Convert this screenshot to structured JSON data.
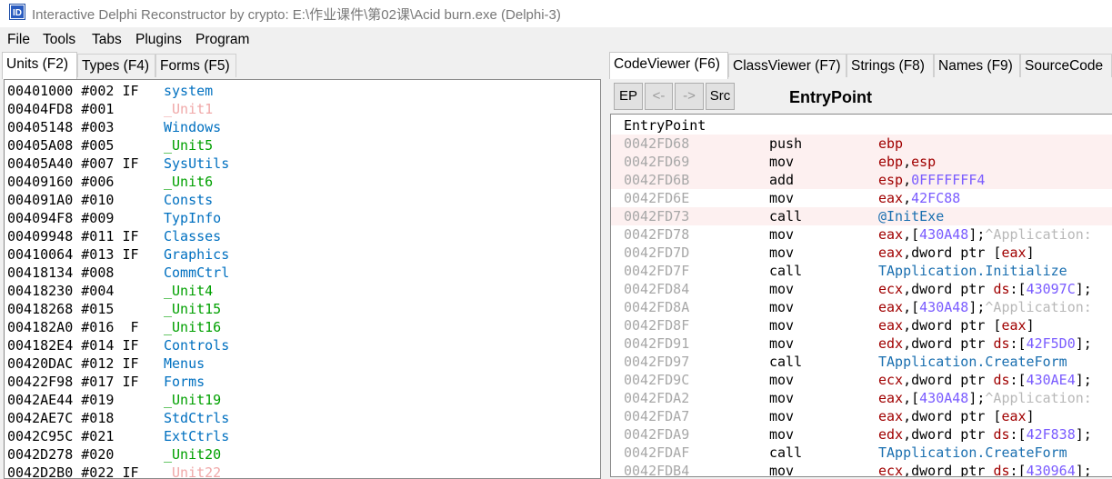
{
  "window": {
    "title": "Interactive Delphi Reconstructor by crypto: E:\\作业课件\\第02课\\Acid burn.exe (Delphi-3)",
    "icon": "idr-app-icon"
  },
  "menu": [
    "File",
    "Tools",
    "Tabs",
    "Plugins",
    "Program"
  ],
  "left_tabs": [
    "Units (F2)",
    "Types (F4)",
    "Forms (F5)"
  ],
  "units": [
    {
      "addr": "00401000",
      "num": "#002",
      "flag": "IF",
      "name": "system",
      "color": "#0070c0"
    },
    {
      "addr": "00404FD8",
      "num": "#001",
      "flag": "",
      "name": "_Unit1",
      "color": "#f0a8a8"
    },
    {
      "addr": "00405148",
      "num": "#003",
      "flag": "",
      "name": "Windows",
      "color": "#0070c0"
    },
    {
      "addr": "00405A08",
      "num": "#005",
      "flag": "",
      "name": "_Unit5",
      "color": "#00a000"
    },
    {
      "addr": "00405A40",
      "num": "#007",
      "flag": "IF",
      "name": "SysUtils",
      "color": "#0070c0"
    },
    {
      "addr": "00409160",
      "num": "#006",
      "flag": "",
      "name": "_Unit6",
      "color": "#00a000"
    },
    {
      "addr": "004091A0",
      "num": "#010",
      "flag": "",
      "name": "Consts",
      "color": "#0070c0"
    },
    {
      "addr": "004094F8",
      "num": "#009",
      "flag": "",
      "name": "TypInfo",
      "color": "#0070c0"
    },
    {
      "addr": "00409948",
      "num": "#011",
      "flag": "IF",
      "name": "Classes",
      "color": "#0070c0"
    },
    {
      "addr": "00410064",
      "num": "#013",
      "flag": "IF",
      "name": "Graphics",
      "color": "#0070c0"
    },
    {
      "addr": "00418134",
      "num": "#008",
      "flag": "",
      "name": "CommCtrl",
      "color": "#0070c0"
    },
    {
      "addr": "00418230",
      "num": "#004",
      "flag": "",
      "name": "_Unit4",
      "color": "#00a000"
    },
    {
      "addr": "00418268",
      "num": "#015",
      "flag": "",
      "name": "_Unit15",
      "color": "#00a000"
    },
    {
      "addr": "004182A0",
      "num": "#016",
      "flag": " F",
      "name": "_Unit16",
      "color": "#00a000"
    },
    {
      "addr": "004182E4",
      "num": "#014",
      "flag": "IF",
      "name": "Controls",
      "color": "#0070c0"
    },
    {
      "addr": "00420DAC",
      "num": "#012",
      "flag": "IF",
      "name": "Menus",
      "color": "#0070c0"
    },
    {
      "addr": "00422F98",
      "num": "#017",
      "flag": "IF",
      "name": "Forms",
      "color": "#0070c0"
    },
    {
      "addr": "0042AE44",
      "num": "#019",
      "flag": "",
      "name": "_Unit19",
      "color": "#00a000"
    },
    {
      "addr": "0042AE7C",
      "num": "#018",
      "flag": "",
      "name": "StdCtrls",
      "color": "#0070c0"
    },
    {
      "addr": "0042C95C",
      "num": "#021",
      "flag": "",
      "name": "ExtCtrls",
      "color": "#0070c0"
    },
    {
      "addr": "0042D278",
      "num": "#020",
      "flag": "",
      "name": "_Unit20",
      "color": "#00a000"
    },
    {
      "addr": "0042D2B0",
      "num": "#022",
      "flag": "IF",
      "name": "_Unit22",
      "color": "#f0a8a8"
    }
  ],
  "right_tabs": [
    "CodeViewer (F6)",
    "ClassViewer (F7)",
    "Strings (F8)",
    "Names (F9)",
    "SourceCode"
  ],
  "toolbar": {
    "buttons": [
      {
        "label": "EP",
        "enabled": true
      },
      {
        "label": "<-",
        "enabled": false
      },
      {
        "label": "->",
        "enabled": false
      },
      {
        "label": "Src",
        "enabled": true
      }
    ],
    "proc_name": "EntryPoint"
  },
  "code": {
    "header": "EntryPoint",
    "rows": [
      {
        "addr": "0042FD68",
        "mnem": "push",
        "hl": true,
        "ops": [
          {
            "t": "ebp",
            "c": "reg"
          }
        ]
      },
      {
        "addr": "0042FD69",
        "mnem": "mov",
        "hl": true,
        "ops": [
          {
            "t": "ebp",
            "c": "reg"
          },
          {
            "t": ",",
            "c": "pl"
          },
          {
            "t": "esp",
            "c": "reg"
          }
        ]
      },
      {
        "addr": "0042FD6B",
        "mnem": "add",
        "hl": true,
        "ops": [
          {
            "t": "esp",
            "c": "reg"
          },
          {
            "t": ",",
            "c": "pl"
          },
          {
            "t": "0FFFFFFF4",
            "c": "num"
          }
        ]
      },
      {
        "addr": "0042FD6E",
        "mnem": "mov",
        "hl": false,
        "ops": [
          {
            "t": "eax",
            "c": "reg"
          },
          {
            "t": ",",
            "c": "pl"
          },
          {
            "t": "42FC88",
            "c": "num"
          }
        ]
      },
      {
        "addr": "0042FD73",
        "mnem": "call",
        "hl": true,
        "ops": [
          {
            "t": "@InitExe",
            "c": "sym"
          }
        ]
      },
      {
        "addr": "0042FD78",
        "mnem": "mov",
        "hl": false,
        "ops": [
          {
            "t": "eax",
            "c": "reg"
          },
          {
            "t": ",[",
            "c": "pl"
          },
          {
            "t": "430A48",
            "c": "num"
          },
          {
            "t": "];",
            "c": "pl"
          },
          {
            "t": "^Application:",
            "c": "cmt"
          }
        ]
      },
      {
        "addr": "0042FD7D",
        "mnem": "mov",
        "hl": false,
        "ops": [
          {
            "t": "eax",
            "c": "reg"
          },
          {
            "t": ",dword ptr [",
            "c": "pl"
          },
          {
            "t": "eax",
            "c": "reg"
          },
          {
            "t": "]",
            "c": "pl"
          }
        ]
      },
      {
        "addr": "0042FD7F",
        "mnem": "call",
        "hl": false,
        "ops": [
          {
            "t": "TApplication.Initialize",
            "c": "sym"
          }
        ]
      },
      {
        "addr": "0042FD84",
        "mnem": "mov",
        "hl": false,
        "ops": [
          {
            "t": "ecx",
            "c": "reg"
          },
          {
            "t": ",dword ptr ",
            "c": "pl"
          },
          {
            "t": "ds",
            "c": "reg"
          },
          {
            "t": ":[",
            "c": "pl"
          },
          {
            "t": "43097C",
            "c": "num"
          },
          {
            "t": "];",
            "c": "pl"
          }
        ]
      },
      {
        "addr": "0042FD8A",
        "mnem": "mov",
        "hl": false,
        "ops": [
          {
            "t": "eax",
            "c": "reg"
          },
          {
            "t": ",[",
            "c": "pl"
          },
          {
            "t": "430A48",
            "c": "num"
          },
          {
            "t": "];",
            "c": "pl"
          },
          {
            "t": "^Application:",
            "c": "cmt"
          }
        ]
      },
      {
        "addr": "0042FD8F",
        "mnem": "mov",
        "hl": false,
        "ops": [
          {
            "t": "eax",
            "c": "reg"
          },
          {
            "t": ",dword ptr [",
            "c": "pl"
          },
          {
            "t": "eax",
            "c": "reg"
          },
          {
            "t": "]",
            "c": "pl"
          }
        ]
      },
      {
        "addr": "0042FD91",
        "mnem": "mov",
        "hl": false,
        "ops": [
          {
            "t": "edx",
            "c": "reg"
          },
          {
            "t": ",dword ptr ",
            "c": "pl"
          },
          {
            "t": "ds",
            "c": "reg"
          },
          {
            "t": ":[",
            "c": "pl"
          },
          {
            "t": "42F5D0",
            "c": "num"
          },
          {
            "t": "];",
            "c": "pl"
          }
        ]
      },
      {
        "addr": "0042FD97",
        "mnem": "call",
        "hl": false,
        "ops": [
          {
            "t": "TApplication.CreateForm",
            "c": "sym"
          }
        ]
      },
      {
        "addr": "0042FD9C",
        "mnem": "mov",
        "hl": false,
        "ops": [
          {
            "t": "ecx",
            "c": "reg"
          },
          {
            "t": ",dword ptr ",
            "c": "pl"
          },
          {
            "t": "ds",
            "c": "reg"
          },
          {
            "t": ":[",
            "c": "pl"
          },
          {
            "t": "430AE4",
            "c": "num"
          },
          {
            "t": "];",
            "c": "pl"
          }
        ]
      },
      {
        "addr": "0042FDA2",
        "mnem": "mov",
        "hl": false,
        "ops": [
          {
            "t": "eax",
            "c": "reg"
          },
          {
            "t": ",[",
            "c": "pl"
          },
          {
            "t": "430A48",
            "c": "num"
          },
          {
            "t": "];",
            "c": "pl"
          },
          {
            "t": "^Application:",
            "c": "cmt"
          }
        ]
      },
      {
        "addr": "0042FDA7",
        "mnem": "mov",
        "hl": false,
        "ops": [
          {
            "t": "eax",
            "c": "reg"
          },
          {
            "t": ",dword ptr [",
            "c": "pl"
          },
          {
            "t": "eax",
            "c": "reg"
          },
          {
            "t": "]",
            "c": "pl"
          }
        ]
      },
      {
        "addr": "0042FDA9",
        "mnem": "mov",
        "hl": false,
        "ops": [
          {
            "t": "edx",
            "c": "reg"
          },
          {
            "t": ",dword ptr ",
            "c": "pl"
          },
          {
            "t": "ds",
            "c": "reg"
          },
          {
            "t": ":[",
            "c": "pl"
          },
          {
            "t": "42F838",
            "c": "num"
          },
          {
            "t": "];",
            "c": "pl"
          }
        ]
      },
      {
        "addr": "0042FDAF",
        "mnem": "call",
        "hl": false,
        "ops": [
          {
            "t": "TApplication.CreateForm",
            "c": "sym"
          }
        ]
      },
      {
        "addr": "0042FDB4",
        "mnem": "mov",
        "hl": false,
        "ops": [
          {
            "t": "ecx",
            "c": "reg"
          },
          {
            "t": ",dword ptr ",
            "c": "pl"
          },
          {
            "t": "ds",
            "c": "reg"
          },
          {
            "t": ":[",
            "c": "pl"
          },
          {
            "t": "430964",
            "c": "num"
          },
          {
            "t": "];",
            "c": "pl"
          }
        ]
      }
    ]
  }
}
